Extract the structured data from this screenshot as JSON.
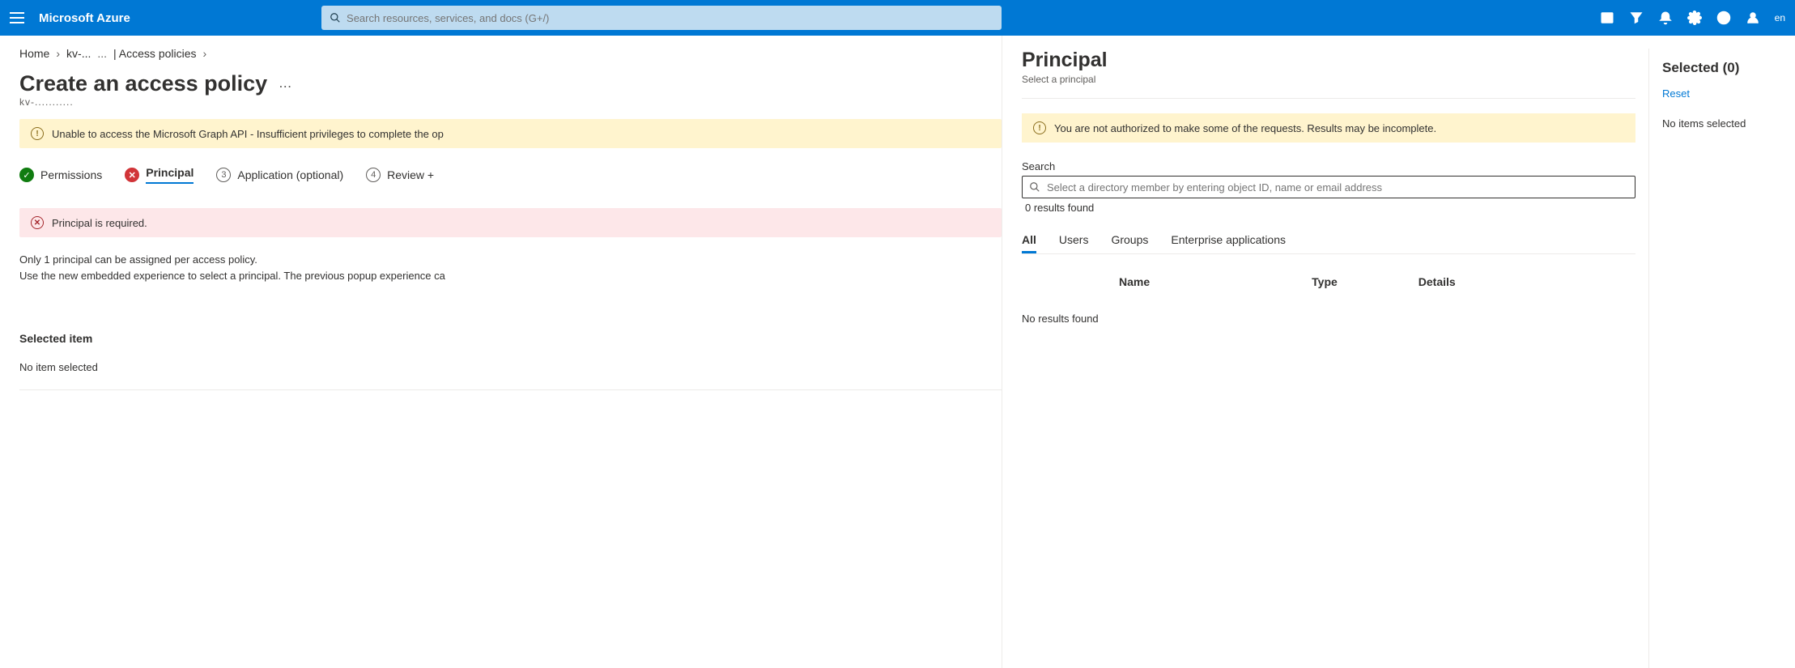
{
  "topbar": {
    "brand": "Microsoft Azure",
    "search_placeholder": "Search resources, services, and docs (G+/)",
    "right_text": "en"
  },
  "breadcrumb": {
    "home": "Home",
    "resource": "kv-...",
    "separator": "...",
    "page": "| Access policies"
  },
  "page": {
    "title": "Create an access policy",
    "subtitle": "kv-..........."
  },
  "warnings": {
    "graph_api": "Unable to access the Microsoft Graph API - Insufficient privileges to complete the op",
    "principal_required": "Principal is required.",
    "not_authorized": "You are not authorized to make some of the requests. Results may be incomplete."
  },
  "steps": [
    {
      "label": "Permissions",
      "state": "done"
    },
    {
      "label": "Principal",
      "state": "err"
    },
    {
      "label": "Application (optional)",
      "number": "3"
    },
    {
      "label": "Review +",
      "number": "4"
    }
  ],
  "info": {
    "line1": "Only 1 principal can be assigned per access policy.",
    "line2": "Use the new embedded experience to select a principal. The previous popup experience ca"
  },
  "selected_item": {
    "heading": "Selected item",
    "value": "No item selected"
  },
  "principal_panel": {
    "title": "Principal",
    "subtitle": "Select a principal",
    "search_label": "Search",
    "search_placeholder": "Select a directory member by entering object ID, name or email address",
    "results_count": "0 results found",
    "tabs": [
      "All",
      "Users",
      "Groups",
      "Enterprise applications"
    ],
    "columns": [
      "Name",
      "Type",
      "Details"
    ],
    "no_results": "No results found"
  },
  "selected_panel": {
    "title": "Selected (0)",
    "reset": "Reset",
    "none": "No items selected"
  }
}
